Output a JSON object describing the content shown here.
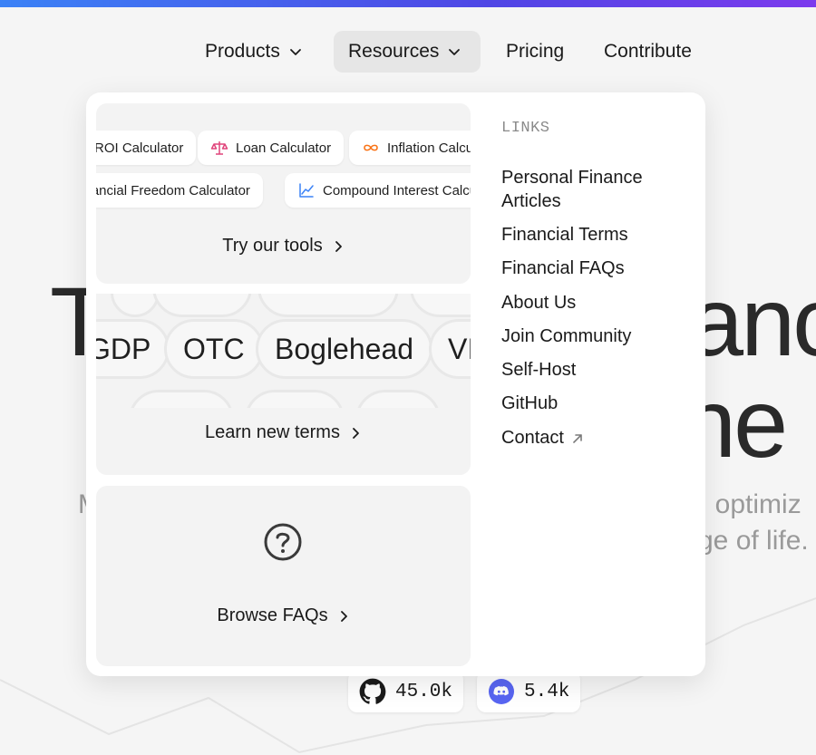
{
  "nav": {
    "products": "Products",
    "resources": "Resources",
    "pricing": "Pricing",
    "contribute": "Contribute"
  },
  "hero": {
    "title_left": "T",
    "title_right_1": "anc",
    "title_right_2": "ne",
    "subtitle_left": "M",
    "subtitle_right_1": "ck, optimiz",
    "subtitle_right_2": "ge of life."
  },
  "dropdown": {
    "tools": {
      "chips_row1": [
        "ROI Calculator",
        "Loan Calculator",
        "Inflation Calculator"
      ],
      "chips_row2": [
        "Financial Freedom Calculator",
        "Compound Interest Calculator"
      ],
      "cta": "Try our tools"
    },
    "terms": {
      "items": [
        "GDP",
        "OTC",
        "Boglehead",
        "VIX"
      ],
      "cta": "Learn new terms"
    },
    "faqs": {
      "cta": "Browse FAQs"
    },
    "links": {
      "title": "LINKS",
      "items": [
        "Personal Finance",
        "Articles",
        "Financial Terms",
        "Financial FAQs",
        "About Us",
        "Join Community",
        "Self-Host",
        "GitHub",
        "Contact"
      ]
    }
  },
  "stats": {
    "github": "45.0k",
    "discord": "5.4k"
  },
  "colors": {
    "loan_icon": "#e0457b",
    "inflation_icon": "#f97316",
    "compound_icon": "#3b82f6",
    "discord": "#5865f2"
  }
}
